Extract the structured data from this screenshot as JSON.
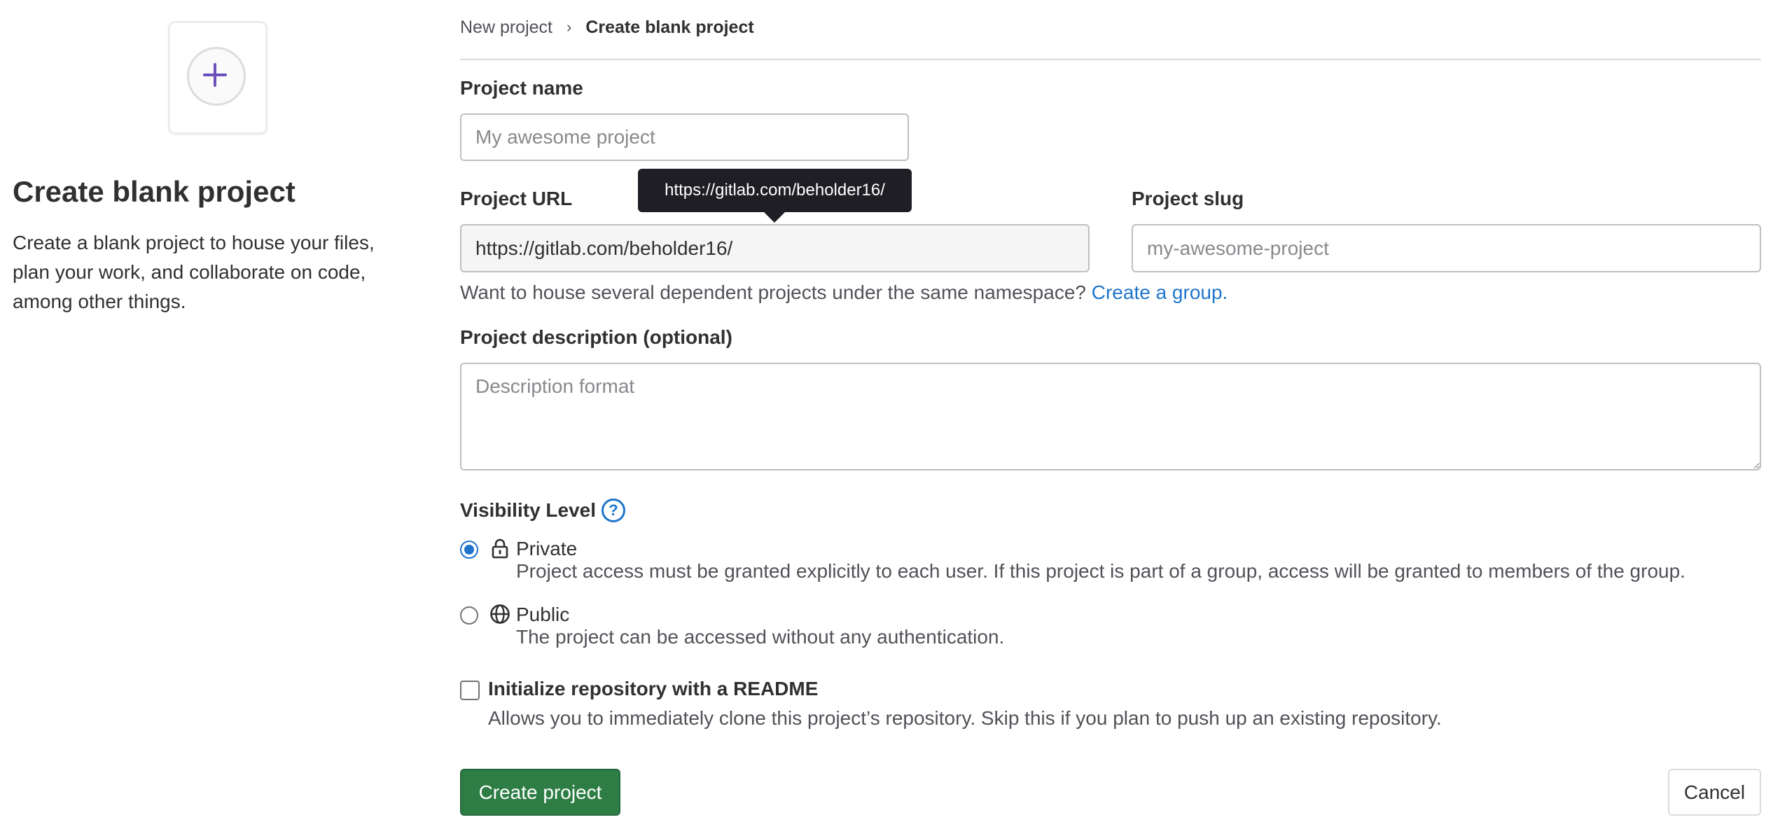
{
  "left_panel": {
    "icon": "plus-icon",
    "title": "Create blank project",
    "description": "Create a blank project to house your files, plan your work, and collaborate on code, among other things."
  },
  "breadcrumb": {
    "items": [
      "New project",
      "Create blank project"
    ],
    "separator": "›"
  },
  "form": {
    "project_name": {
      "label": "Project name",
      "value": "",
      "placeholder": "My awesome project"
    },
    "project_url": {
      "label": "Project URL",
      "value": "https://gitlab.com/beholder16/",
      "tooltip": "https://gitlab.com/beholder16/"
    },
    "project_slug": {
      "label": "Project slug",
      "value": "",
      "placeholder": "my-awesome-project"
    },
    "namespace_help": {
      "text": "Want to house several dependent projects under the same namespace?",
      "link": "Create a group."
    },
    "description": {
      "label": "Project description (optional)",
      "value": "",
      "placeholder": "Description format"
    },
    "visibility": {
      "label": "Visibility Level",
      "help_icon": "question-circle-icon",
      "help_glyph": "?",
      "options": [
        {
          "title": "Private",
          "icon": "lock-icon",
          "description": "Project access must be granted explicitly to each user. If this project is part of a group, access will be granted to members of the group.",
          "selected": true
        },
        {
          "title": "Public",
          "icon": "globe-icon",
          "description": "The project can be accessed without any authentication.",
          "selected": false
        }
      ]
    },
    "readme": {
      "title": "Initialize repository with a README",
      "description": "Allows you to immediately clone this project’s repository. Skip this if you plan to push up an existing repository.",
      "checked": false
    },
    "buttons": {
      "create": "Create project",
      "cancel": "Cancel"
    }
  },
  "colors": {
    "accent": "#1f75cb",
    "primary_button": "#2e7d45",
    "tooltip_bg": "#1f1e24",
    "plus_icon": "#6b4fbb"
  }
}
